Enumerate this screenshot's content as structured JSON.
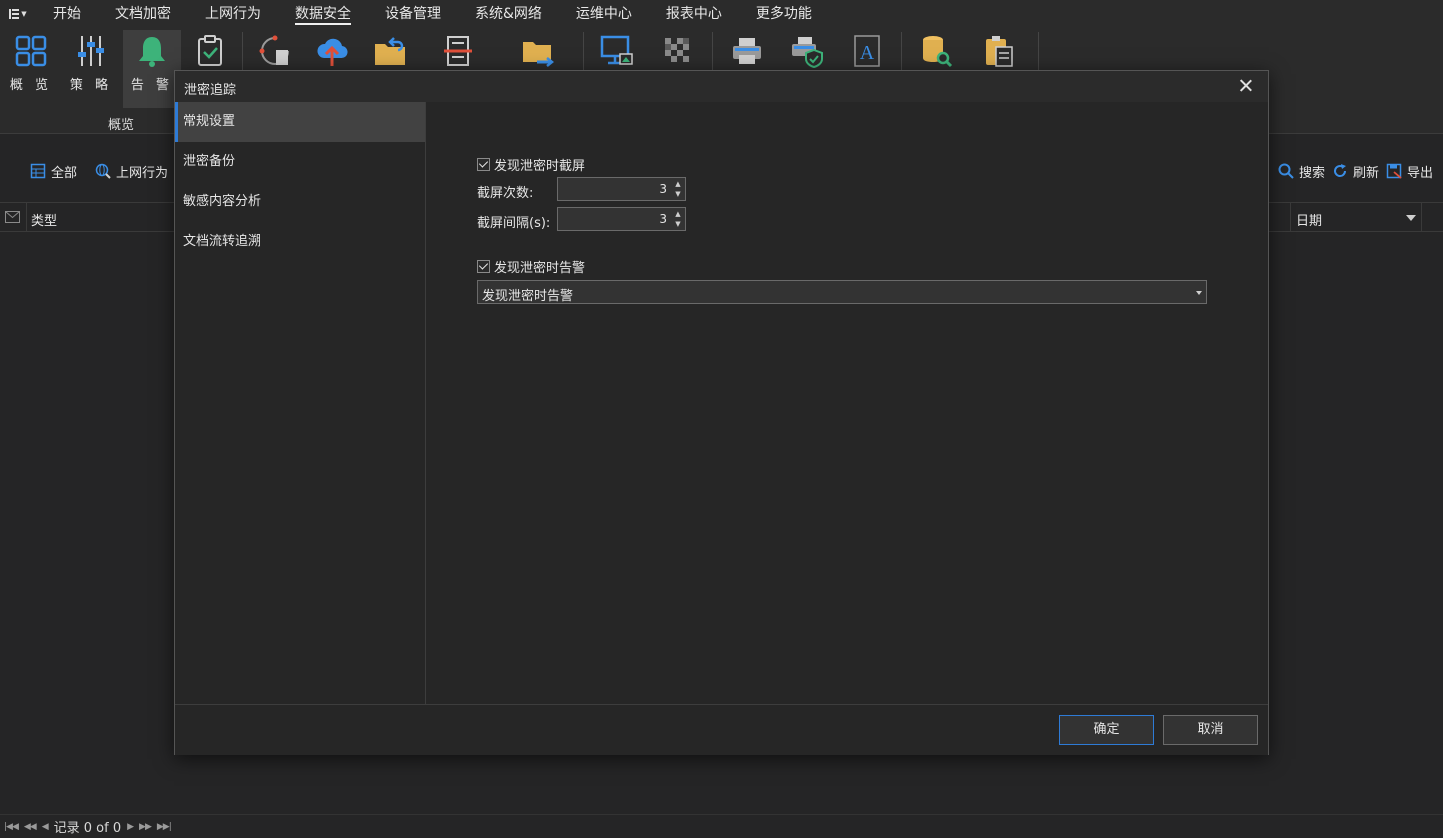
{
  "menubar": {
    "items": [
      "开始",
      "文档加密",
      "上网行为",
      "数据安全",
      "设备管理",
      "系统&网络",
      "运维中心",
      "报表中心",
      "更多功能"
    ],
    "active": "数据安全"
  },
  "ribbon": {
    "buttons": [
      {
        "label": "概 览",
        "icon": "overview-grid-icon"
      },
      {
        "label": "策 略",
        "icon": "strategy-sliders-icon"
      },
      {
        "label": "告 警",
        "icon": "alert-bell-icon"
      }
    ],
    "group_label": "概览"
  },
  "toolbar": {
    "all_label": "全部",
    "web_label": "上网行为",
    "search_label": "搜索",
    "refresh_label": "刷新",
    "export_label": "导出"
  },
  "grid": {
    "col_type": "类型",
    "col_date": "日期"
  },
  "footer": {
    "record_text": "记录 0 of 0"
  },
  "dialog": {
    "title": "泄密追踪",
    "nav": [
      "常规设置",
      "泄密备份",
      "敏感内容分析",
      "文档流转追溯"
    ],
    "active_nav": "常规设置",
    "screenshot_checkbox": "发现泄密时截屏",
    "screenshot_checked": true,
    "count_label": "截屏次数:",
    "count_value": "3",
    "interval_label": "截屏间隔(s):",
    "interval_value": "3",
    "alert_checkbox": "发现泄密时告警",
    "alert_checked": true,
    "alert_select_value": "发现泄密时告警",
    "ok_label": "确定",
    "cancel_label": "取消"
  },
  "colors": {
    "background": "#252526",
    "accent": "#2e7bd6",
    "bell": "#3db37a",
    "folder": "#e0b050",
    "icon_blue": "#3a8ee6"
  }
}
